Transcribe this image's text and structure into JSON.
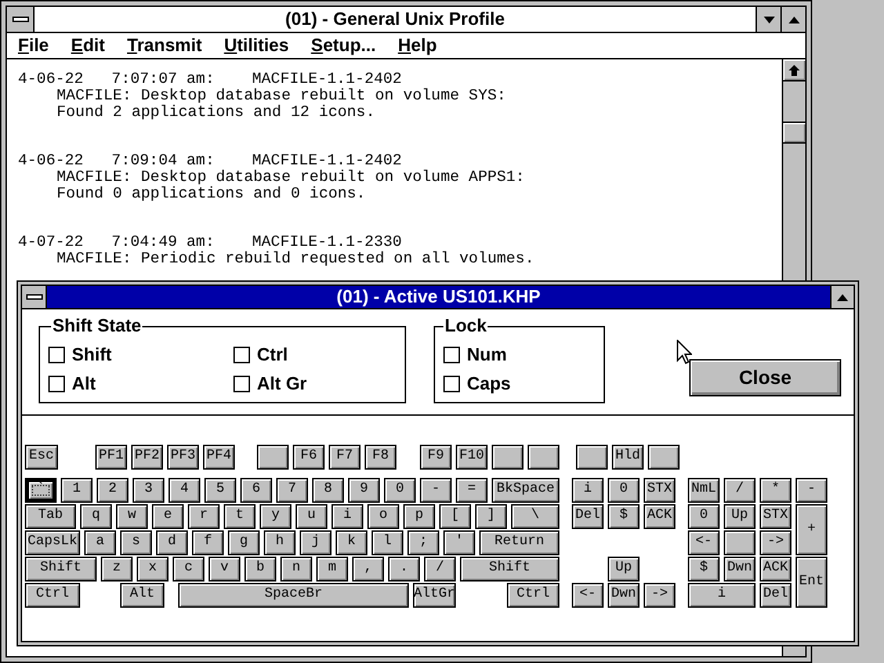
{
  "main_window": {
    "title": "(01) - General Unix Profile",
    "menu": [
      {
        "label": "File"
      },
      {
        "label": "Edit"
      },
      {
        "label": "Transmit"
      },
      {
        "label": "Utilities"
      },
      {
        "label": "Setup..."
      },
      {
        "label": "Help"
      }
    ],
    "log": [
      {
        "header": "4-06-22   7:07:07 am:    MACFILE-1.1-2402",
        "lines": [
          "MACFILE: Desktop database rebuilt on volume SYS:",
          "Found 2 applications and 12 icons."
        ]
      },
      {
        "header": "4-06-22   7:09:04 am:    MACFILE-1.1-2402",
        "lines": [
          "MACFILE: Desktop database rebuilt on volume APPS1:",
          "Found 0 applications and 0 icons."
        ]
      },
      {
        "header": "4-07-22   7:04:49 am:    MACFILE-1.1-2330",
        "lines": [
          "MACFILE: Periodic rebuild requested on all volumes."
        ]
      }
    ]
  },
  "dialog": {
    "title": "(01) - Active US101.KHP",
    "shift_state": {
      "title": "Shift State",
      "options": [
        {
          "label": "Shift",
          "checked": false
        },
        {
          "label": "Ctrl",
          "checked": false
        },
        {
          "label": "Alt",
          "checked": false
        },
        {
          "label": "Alt Gr",
          "checked": false
        }
      ]
    },
    "lock": {
      "title": "Lock",
      "options": [
        {
          "label": "Num",
          "checked": false
        },
        {
          "label": "Caps",
          "checked": false
        }
      ]
    },
    "close_button": "Close",
    "keyboard": {
      "function_row": [
        {
          "kind": "key",
          "label": "Esc",
          "focused": false
        },
        {
          "kind": "key",
          "label": "PF1",
          "focused": false
        },
        {
          "kind": "key",
          "label": "PF2",
          "focused": false
        },
        {
          "kind": "key",
          "label": "PF3",
          "focused": false
        },
        {
          "kind": "key",
          "label": "PF4",
          "focused": false
        },
        {
          "kind": "blank",
          "focused": false
        },
        {
          "kind": "key",
          "label": "F6",
          "focused": false
        },
        {
          "kind": "key",
          "label": "F7",
          "focused": false
        },
        {
          "kind": "key",
          "label": "F8",
          "focused": false
        },
        {
          "kind": "key",
          "label": "F9",
          "focused": false
        },
        {
          "kind": "key",
          "label": "F10",
          "focused": false
        },
        {
          "kind": "blank",
          "focused": false
        },
        {
          "kind": "blank",
          "focused": false
        }
      ],
      "rows": [
        {
          "keys": [
            {
              "kind": "key",
              "label": "`",
              "focused": true
            },
            {
              "kind": "key",
              "label": "1",
              "focused": false
            },
            {
              "kind": "key",
              "label": "2",
              "focused": false
            },
            {
              "kind": "key",
              "label": "3",
              "focused": false
            },
            {
              "kind": "key",
              "label": "4",
              "focused": false
            },
            {
              "kind": "key",
              "label": "5",
              "focused": false
            },
            {
              "kind": "key",
              "label": "6",
              "focused": false
            },
            {
              "kind": "key",
              "label": "7",
              "focused": false
            },
            {
              "kind": "key",
              "label": "8",
              "focused": false
            },
            {
              "kind": "key",
              "label": "9",
              "focused": false
            },
            {
              "kind": "key",
              "label": "0",
              "focused": false
            },
            {
              "kind": "key",
              "label": "-",
              "focused": false
            },
            {
              "kind": "key",
              "label": "=",
              "focused": false
            },
            {
              "kind": "key",
              "label": "BkSpace",
              "focused": false
            }
          ]
        },
        {
          "keys": [
            {
              "kind": "key",
              "label": "Tab",
              "focused": false
            },
            {
              "kind": "key",
              "label": "q",
              "focused": false
            },
            {
              "kind": "key",
              "label": "w",
              "focused": false
            },
            {
              "kind": "key",
              "label": "e",
              "focused": false
            },
            {
              "kind": "key",
              "label": "r",
              "focused": false
            },
            {
              "kind": "key",
              "label": "t",
              "focused": false
            },
            {
              "kind": "key",
              "label": "y",
              "focused": false
            },
            {
              "kind": "key",
              "label": "u",
              "focused": false
            },
            {
              "kind": "key",
              "label": "i",
              "focused": false
            },
            {
              "kind": "key",
              "label": "o",
              "focused": false
            },
            {
              "kind": "key",
              "label": "p",
              "focused": false
            },
            {
              "kind": "key",
              "label": "[",
              "focused": false
            },
            {
              "kind": "key",
              "label": "]",
              "focused": false
            },
            {
              "kind": "key",
              "label": "\\",
              "focused": false
            }
          ]
        },
        {
          "keys": [
            {
              "kind": "key",
              "label": "CapsLk",
              "focused": false
            },
            {
              "kind": "key",
              "label": "a",
              "focused": false
            },
            {
              "kind": "key",
              "label": "s",
              "focused": false
            },
            {
              "kind": "key",
              "label": "d",
              "focused": false
            },
            {
              "kind": "key",
              "label": "f",
              "focused": false
            },
            {
              "kind": "key",
              "label": "g",
              "focused": false
            },
            {
              "kind": "key",
              "label": "h",
              "focused": false
            },
            {
              "kind": "key",
              "label": "j",
              "focused": false
            },
            {
              "kind": "key",
              "label": "k",
              "focused": false
            },
            {
              "kind": "key",
              "label": "l",
              "focused": false
            },
            {
              "kind": "key",
              "label": ";",
              "focused": false
            },
            {
              "kind": "key",
              "label": "'",
              "focused": false
            },
            {
              "kind": "key",
              "label": "Return",
              "focused": false
            }
          ]
        },
        {
          "keys": [
            {
              "kind": "key",
              "label": "Shift",
              "focused": false
            },
            {
              "kind": "key",
              "label": "z",
              "focused": false
            },
            {
              "kind": "key",
              "label": "x",
              "focused": false
            },
            {
              "kind": "key",
              "label": "c",
              "focused": false
            },
            {
              "kind": "key",
              "label": "v",
              "focused": false
            },
            {
              "kind": "key",
              "label": "b",
              "focused": false
            },
            {
              "kind": "key",
              "label": "n",
              "focused": false
            },
            {
              "kind": "key",
              "label": "m",
              "focused": false
            },
            {
              "kind": "key",
              "label": ",",
              "focused": false
            },
            {
              "kind": "key",
              "label": ".",
              "focused": false
            },
            {
              "kind": "key",
              "label": "/",
              "focused": false
            },
            {
              "kind": "key",
              "label": "Shift",
              "focused": false
            }
          ]
        },
        {
          "keys": [
            {
              "kind": "key",
              "label": "Ctrl",
              "focused": false
            },
            {
              "kind": "key",
              "label": "Alt",
              "focused": false
            },
            {
              "kind": "key",
              "label": "SpaceBr",
              "focused": false
            },
            {
              "kind": "key",
              "label": "AltGr",
              "focused": false
            },
            {
              "kind": "key",
              "label": "Ctrl",
              "focused": false
            }
          ]
        }
      ],
      "nav_function_row": [
        {
          "kind": "blank",
          "focused": false
        },
        {
          "kind": "key",
          "label": "Hld",
          "focused": false
        },
        {
          "kind": "blank",
          "focused": false
        }
      ],
      "nav_keys": [
        {
          "kind": "key",
          "label": "i",
          "focused": false
        },
        {
          "kind": "key",
          "label": "0",
          "focused": false
        },
        {
          "kind": "key",
          "label": "STX",
          "focused": false
        },
        {
          "kind": "key",
          "label": "Del",
          "focused": false
        },
        {
          "kind": "key",
          "label": "$",
          "focused": false
        },
        {
          "kind": "key",
          "label": "ACK",
          "focused": false
        },
        {
          "kind": "key",
          "label": "Up",
          "focused": false
        },
        {
          "kind": "key",
          "label": "<-",
          "focused": false
        },
        {
          "kind": "key",
          "label": "Dwn",
          "focused": false
        },
        {
          "kind": "key",
          "label": "->",
          "focused": false
        }
      ],
      "numpad_keys": [
        {
          "kind": "key",
          "label": "NmL",
          "focused": false
        },
        {
          "kind": "key",
          "label": "/",
          "focused": false
        },
        {
          "kind": "key",
          "label": "*",
          "focused": false
        },
        {
          "kind": "key",
          "label": "-",
          "focused": false
        },
        {
          "kind": "key",
          "label": "0",
          "focused": false
        },
        {
          "kind": "key",
          "label": "Up",
          "focused": false
        },
        {
          "kind": "key",
          "label": "STX",
          "focused": false
        },
        {
          "kind": "key",
          "label": "+",
          "focused": false
        },
        {
          "kind": "key",
          "label": "<-",
          "focused": false
        },
        {
          "kind": "blank",
          "focused": false
        },
        {
          "kind": "key",
          "label": "->",
          "focused": false
        },
        {
          "kind": "key",
          "label": "$",
          "focused": false
        },
        {
          "kind": "key",
          "label": "Dwn",
          "focused": false
        },
        {
          "kind": "key",
          "label": "ACK",
          "focused": false
        },
        {
          "kind": "key",
          "label": "Ent",
          "focused": false
        },
        {
          "kind": "key",
          "label": "i",
          "focused": false
        },
        {
          "kind": "key",
          "label": "Del",
          "focused": false
        }
      ]
    }
  }
}
